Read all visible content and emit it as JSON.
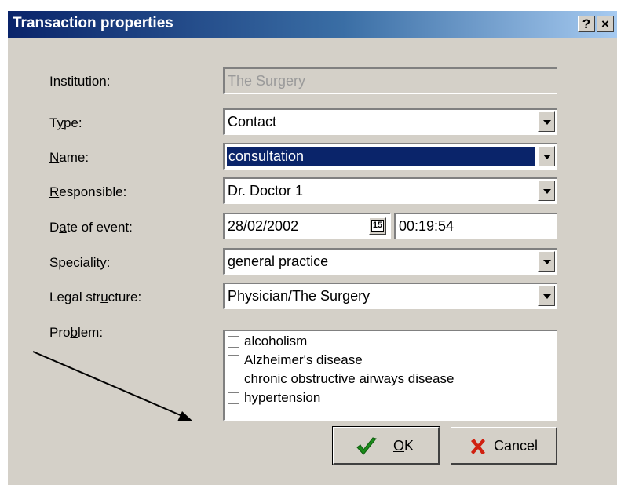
{
  "dialog": {
    "title": "Transaction properties",
    "help_label": "?",
    "close_label": "×"
  },
  "form": {
    "institution": {
      "label": "Institution:",
      "value": "The Surgery"
    },
    "type": {
      "label_pre": "T",
      "label_u": "y",
      "label_post": "pe:",
      "value": "Contact"
    },
    "name": {
      "label_u": "N",
      "label_post": "ame:",
      "value": "consultation"
    },
    "responsible": {
      "label_u": "R",
      "label_post": "esponsible:",
      "value": "Dr. Doctor 1"
    },
    "date": {
      "label_pre": "D",
      "label_u": "a",
      "label_post": "te of event:",
      "date_value": "28/02/2002",
      "calendar_label": "15",
      "time_value": "00:19:54"
    },
    "speciality": {
      "label_u": "S",
      "label_post": "peciality:",
      "value": "general practice"
    },
    "legal": {
      "label_pre": "Legal str",
      "label_u": "u",
      "label_post": "cture:",
      "value": "Physician/The Surgery"
    },
    "problem": {
      "label_pre": "Pro",
      "label_u": "b",
      "label_post": "lem:",
      "items": [
        "alcoholism",
        "Alzheimer's disease",
        "chronic obstructive airways disease",
        "hypertension"
      ]
    }
  },
  "buttons": {
    "ok_label_u": "O",
    "ok_label_post": "K",
    "cancel_label": "Cancel"
  },
  "icons": {
    "ok": "checkmark-icon",
    "cancel": "x-icon",
    "calendar": "calendar-icon"
  },
  "colors": {
    "selection": "#0a246a",
    "ok_check": "#1a8a1a",
    "cancel_x": "#d02010"
  }
}
